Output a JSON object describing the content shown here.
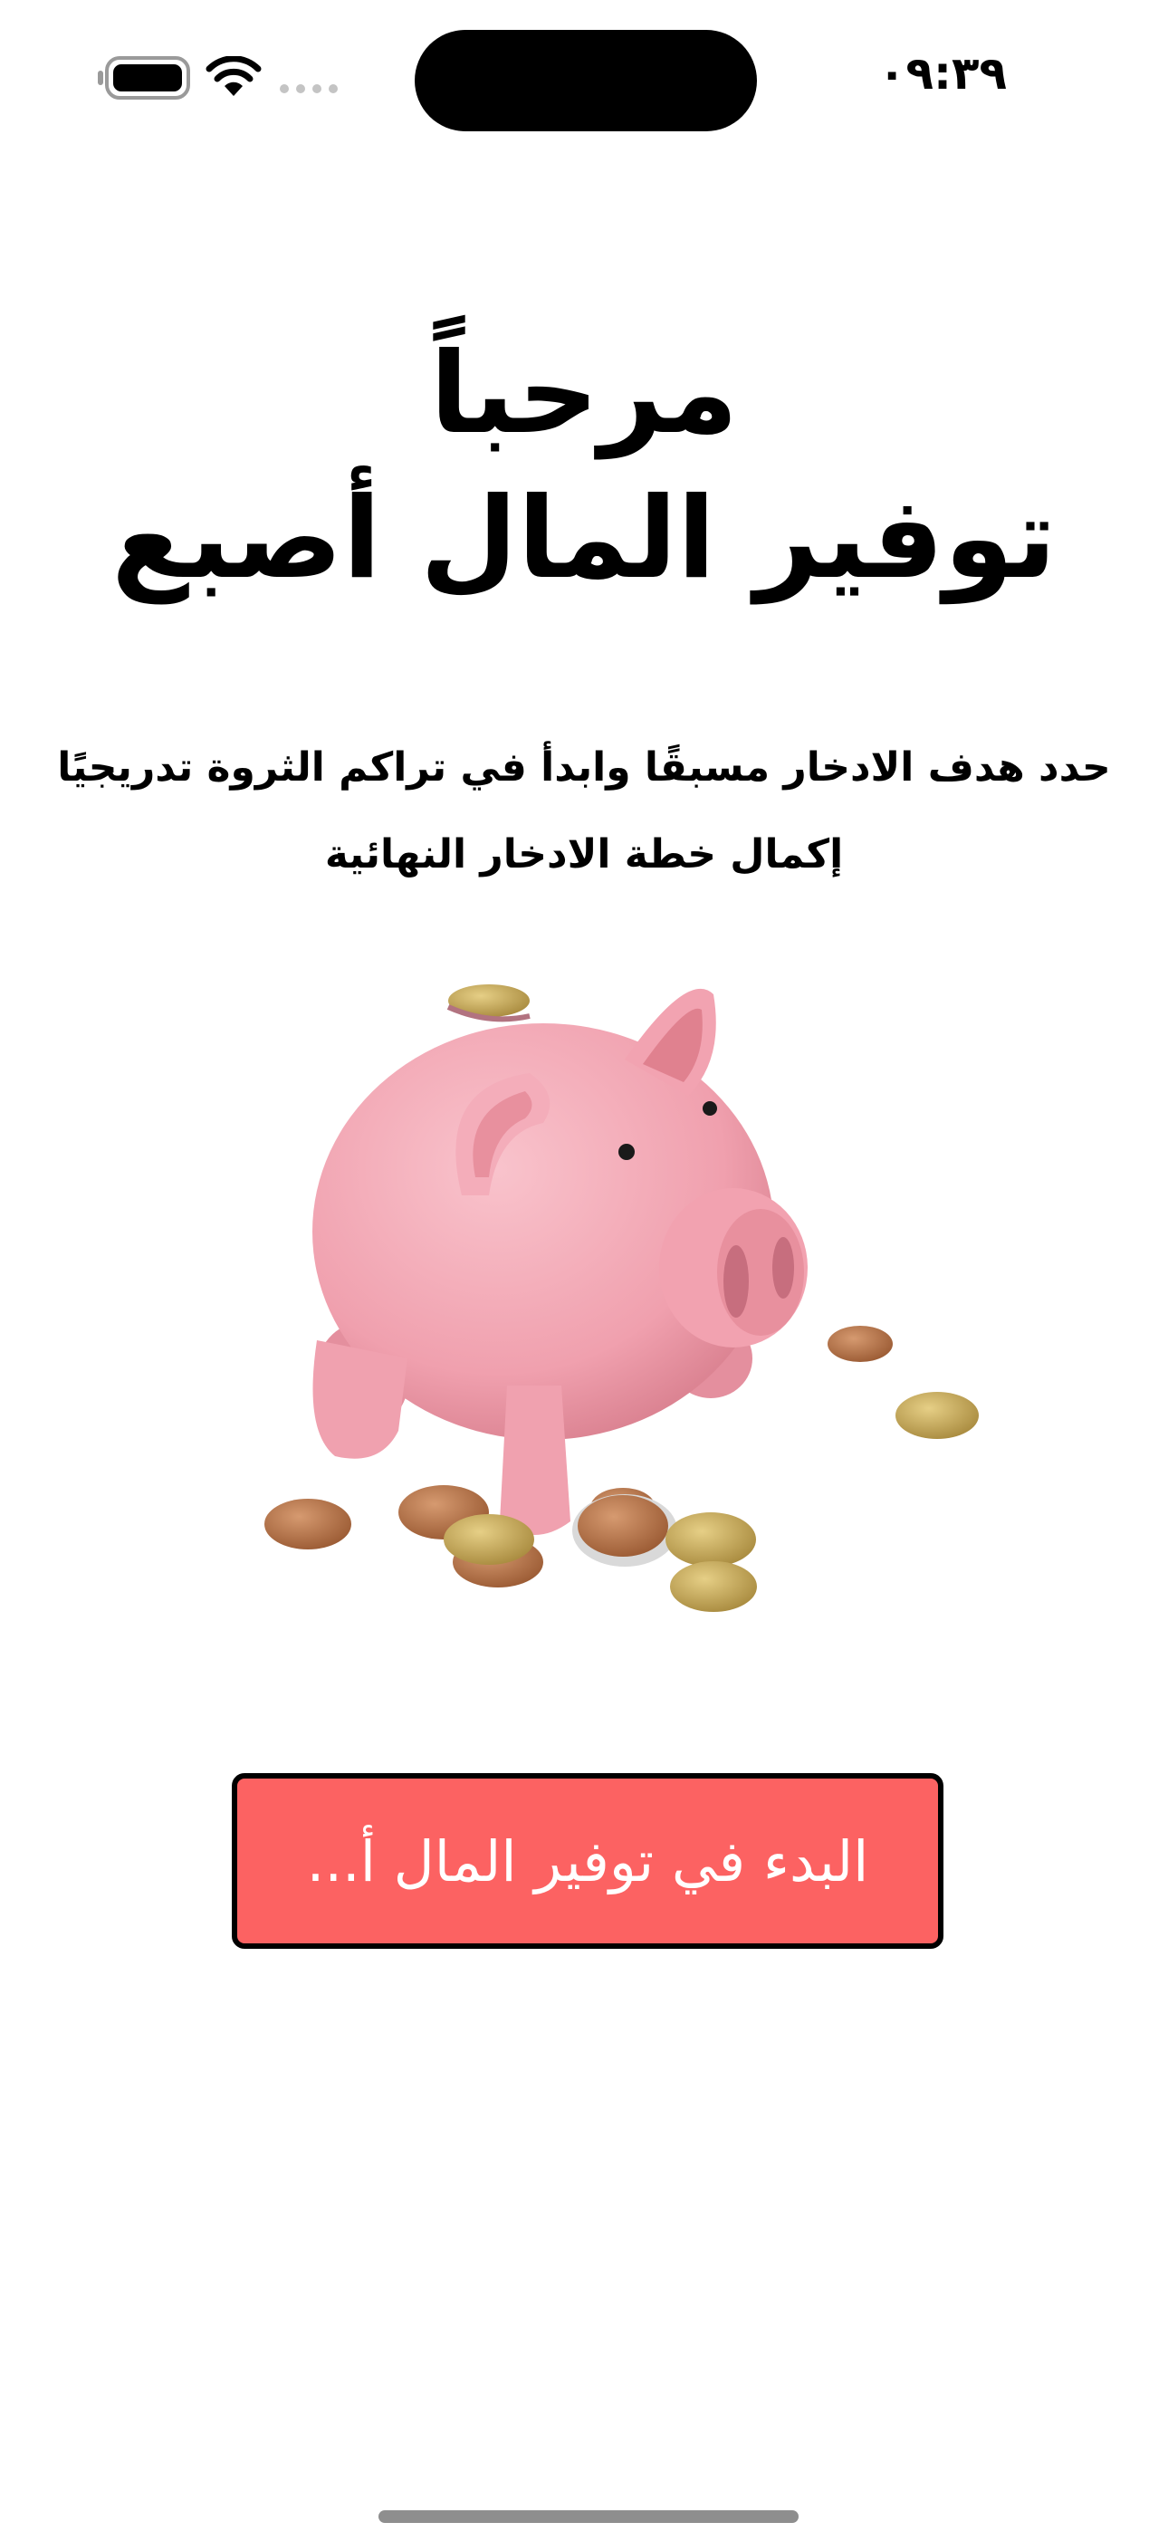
{
  "status_bar": {
    "time": "٠٩:٣٩"
  },
  "headline": {
    "line1": "مرحباً",
    "line2": "توفير المال أصبع"
  },
  "subtitle": {
    "line1": "حدد هدف الادخار مسبقًا وابدأ في تراكم الثروة تدريجيًا",
    "line2": "إكمال خطة الادخار النهائية"
  },
  "illustration": {
    "icon": "piggy-bank-with-coins-icon"
  },
  "cta": {
    "label": "البدء في توفير المال أ...",
    "color": "#fc6262"
  }
}
